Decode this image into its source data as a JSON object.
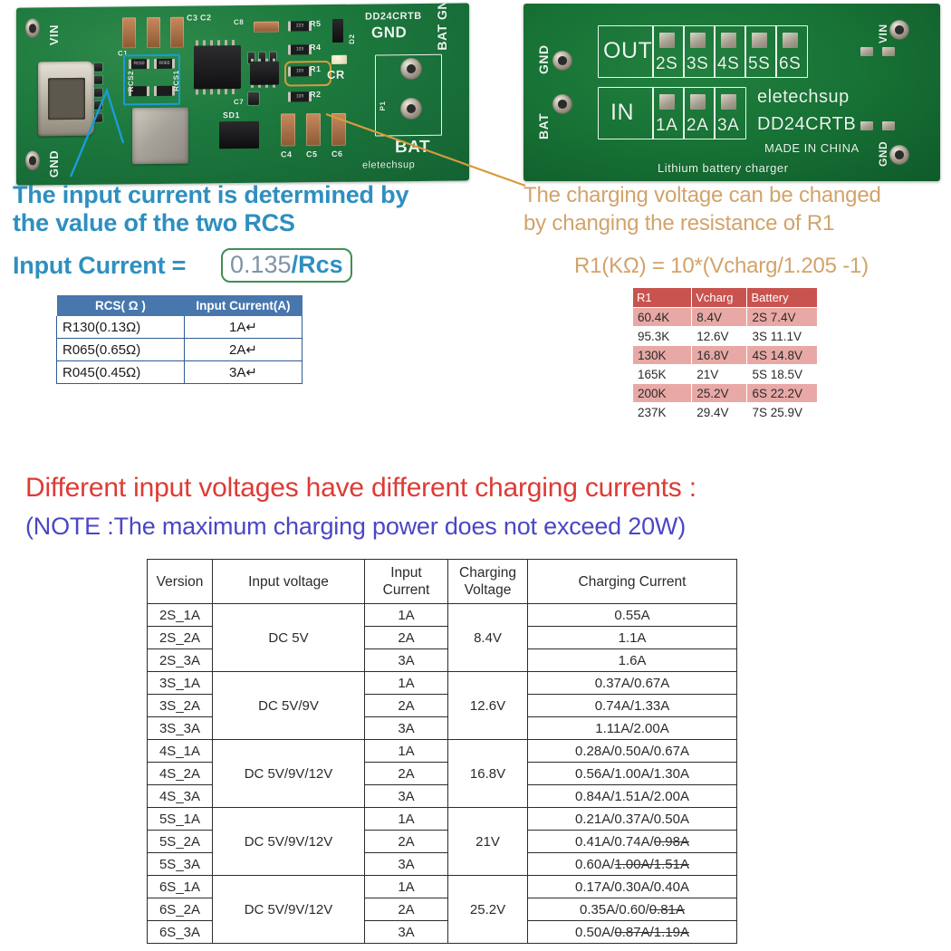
{
  "boards": {
    "left": {
      "name": "pcb-front-view",
      "silkscreen": {
        "part_number": "DD24CRTB",
        "brand": "eletechsup",
        "labels": [
          "VIN",
          "GND",
          "GND",
          "BAT GND",
          "BAT",
          "CR",
          "P1",
          "C1",
          "C2",
          "C3",
          "C7",
          "C8",
          "C4",
          "C5",
          "C6",
          "R1",
          "R2",
          "R4",
          "R5",
          "D2",
          "SD1",
          "RCS1",
          "RCS2"
        ],
        "rcs1_marking": "R030",
        "rcs2_marking": "R065",
        "r1_marking": "103",
        "r2_marking": "103",
        "r4_marking": "103",
        "r5_marking": "223"
      }
    },
    "right": {
      "name": "pcb-back-view",
      "silkscreen": {
        "out_label": "OUT",
        "out_options": [
          "2S",
          "3S",
          "4S",
          "5S",
          "6S"
        ],
        "in_label": "IN",
        "in_options": [
          "1A",
          "2A",
          "3A"
        ],
        "brand": "eletechsup",
        "part_number": "DD24CRTB",
        "origin": "MADE IN CHINA",
        "description": "Lithium battery charger",
        "terminals": [
          "GND",
          "BAT",
          "VIN",
          "GND"
        ]
      }
    }
  },
  "annotations": {
    "left": {
      "line1": "The input current is determined by",
      "line2": "the value of the two RCS",
      "line3_label": "Input Current =",
      "formula_numerator": "0.135",
      "formula_denominator": "/Rcs",
      "highlight_color": "#1b9bd8",
      "text_color": "#2e8fc0",
      "formula_box_color": "#3f8f55"
    },
    "right": {
      "line1": "The charging voltage can be changed",
      "line2": "by changing the resistance of R1",
      "line3": "R1(KΩ) = 10*(Vcharg/1.205 -1)",
      "highlight_color": "#d79b3c",
      "text_color": "#d2a36a"
    }
  },
  "rcs_table": {
    "name": "rcs-input-current-table",
    "headers": [
      "RCS( Ω )",
      "Input Current(A)"
    ],
    "header_bg": "#4777ad",
    "rows": [
      [
        "R130(0.13Ω)",
        "1A↵"
      ],
      [
        "R065(0.65Ω)",
        "2A↵"
      ],
      [
        "R045(0.45Ω)",
        "3A↵"
      ]
    ]
  },
  "r1_table": {
    "name": "r1-voltage-battery-table",
    "headers": [
      "R1",
      "Vcharg",
      "Battery"
    ],
    "header_bg": "#c8534f",
    "alt_row_bg": "#e8a9a6",
    "rows": [
      [
        "60.4K",
        "8.4V",
        "2S 7.4V"
      ],
      [
        "95.3K",
        "12.6V",
        "3S 11.1V"
      ],
      [
        "130K",
        "16.8V",
        "4S 14.8V"
      ],
      [
        "165K",
        "21V",
        "5S 18.5V"
      ],
      [
        "200K",
        "25.2V",
        "6S 22.2V"
      ],
      [
        "237K",
        "29.4V",
        "7S 25.9V"
      ]
    ]
  },
  "headings": {
    "main": "Different input voltages have different charging currents :",
    "main_color": "#dd3b35",
    "note": "(NOTE :The maximum charging power does not exceed 20W)",
    "note_color": "#4b46c4"
  },
  "main_table": {
    "name": "charging-current-table",
    "headers": [
      "Version",
      "Input voltage",
      "Input Current",
      "Charging Voltage",
      "Charging Current"
    ],
    "header_lines": {
      "h1": "Version",
      "h2": "Input voltage",
      "h3a": "Input",
      "h3b": "Current",
      "h4a": "Charging",
      "h4b": "Voltage",
      "h5": "Charging Current"
    },
    "groups": [
      {
        "color": "#3aa8a8",
        "input_voltage": "DC 5V",
        "charging_voltage": "8.4V",
        "rows": [
          {
            "version": "2S_1A",
            "input_current": "1A",
            "charging_current": "0.55A",
            "struck": ""
          },
          {
            "version": "2S_2A",
            "input_current": "2A",
            "charging_current": "1.1A",
            "struck": ""
          },
          {
            "version": "2S_3A",
            "input_current": "3A",
            "charging_current": "1.6A",
            "struck": ""
          }
        ]
      },
      {
        "color": "#3a3a3a",
        "input_voltage": "DC 5V/9V",
        "charging_voltage": "12.6V",
        "rows": [
          {
            "version": "3S_1A",
            "input_current": "1A",
            "charging_current": "0.37A/0.67A",
            "struck": ""
          },
          {
            "version": "3S_2A",
            "input_current": "2A",
            "charging_current": "0.74A/1.33A",
            "struck": ""
          },
          {
            "version": "3S_3A",
            "input_current": "3A",
            "charging_current": "1.11A/2.00A",
            "struck": ""
          }
        ]
      },
      {
        "color": "#c4524f",
        "input_voltage": "DC 5V/9V/12V",
        "charging_voltage": "16.8V",
        "rows": [
          {
            "version": "4S_1A",
            "input_current": "1A",
            "charging_current": "0.28A/0.50A/0.67A",
            "struck": ""
          },
          {
            "version": "4S_2A",
            "input_current": "2A",
            "charging_current": "0.56A/1.00A/1.30A",
            "struck": ""
          },
          {
            "version": "4S_3A",
            "input_current": "3A",
            "charging_current": "0.84A/1.51A/2.00A",
            "struck": ""
          }
        ]
      },
      {
        "color": "#3aa8a8",
        "input_voltage": "DC 5V/9V/12V",
        "charging_voltage": "21V",
        "rows": [
          {
            "version": "5S_1A",
            "input_current": "1A",
            "charging_current": "0.21A/0.37A/0.50A",
            "struck": ""
          },
          {
            "version": "5S_2A",
            "input_current": "2A",
            "charging_current": "0.41A/0.74A/",
            "struck": "0.98A"
          },
          {
            "version": "5S_3A",
            "input_current": "3A",
            "charging_current": "0.60A/",
            "struck": "1.00A/1.51A"
          }
        ]
      },
      {
        "color": "#3a3a3a",
        "input_voltage": "DC 5V/9V/12V",
        "charging_voltage": "25.2V",
        "rows": [
          {
            "version": "6S_1A",
            "input_current": "1A",
            "charging_current": "0.17A/0.30A/0.40A",
            "struck": ""
          },
          {
            "version": "6S_2A",
            "input_current": "2A",
            "charging_current": "0.35A/0.60/",
            "struck": "0.81A"
          },
          {
            "version": "6S_3A",
            "input_current": "3A",
            "charging_current": "0.50A/",
            "struck": "0.87A/1.19A"
          }
        ]
      }
    ]
  }
}
